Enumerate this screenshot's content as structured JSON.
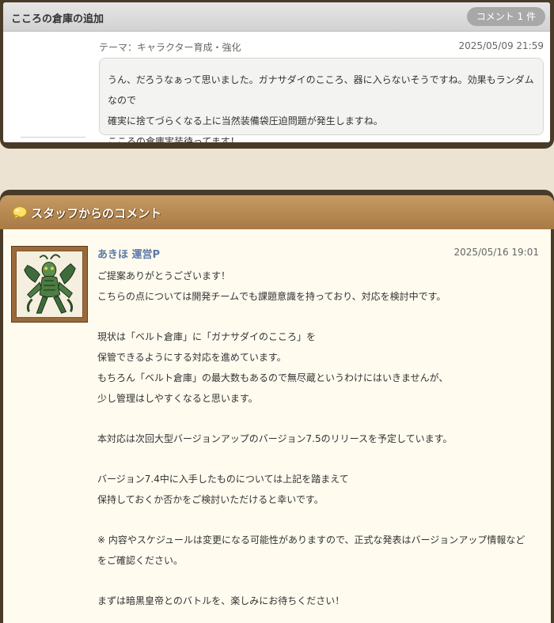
{
  "post": {
    "title": "こころの倉庫の追加",
    "comment_count": "コメント 1 件",
    "theme": "テーマ：キャラクター育成・強化",
    "date": "2025/05/09 21:59",
    "lines": [
      "うん、だろうなぁって思いました。ガナサダイのこころ、器に入らないそうですね。効果もランダムなので",
      "確実に捨てづらくなる上に当然装備袋圧迫問題が発生しますね。",
      "こころの倉庫実装待ってます！"
    ]
  },
  "staff": {
    "header": "スタッフからのコメント",
    "name": "あきほ 運営P",
    "date": "2025/05/16 19:01",
    "lines": [
      "ご提案ありがとうございます！",
      "こちらの点については開発チームでも課題意識を持っており、対応を検討中です。",
      "",
      "現状は「ベルト倉庫」に「ガナサダイのこころ」を",
      "保管できるようにする対応を進めています。",
      "もちろん「ベルト倉庫」の最大数もあるので無尽蔵というわけにはいきませんが、",
      "少し管理はしやすくなると思います。",
      "",
      "本対応は次回大型バージョンアップのバージョン7.5のリリースを予定しています。",
      "",
      "バージョン7.4中に入手したものについては上記を踏まえて",
      "保持しておくか否かをご検討いただけると幸いです。",
      "",
      "※ 内容やスケジュールは変更になる可能性がありますので、正式な発表はバージョンアップ情報など",
      "をご確認ください。",
      "",
      "まずは暗黒皇帝とのバトルを、楽しみにお待ちください！"
    ]
  },
  "colors": {
    "frame": "#4a3a28",
    "staff_header": "#b88a53",
    "staff_name": "#5b78a8",
    "staff_body_bg": "#fffbef",
    "comment_pill": "#a8a8a8"
  },
  "icons": {
    "speech_bubble": "speech-bubble-icon",
    "avatar": "monster-avatar"
  }
}
